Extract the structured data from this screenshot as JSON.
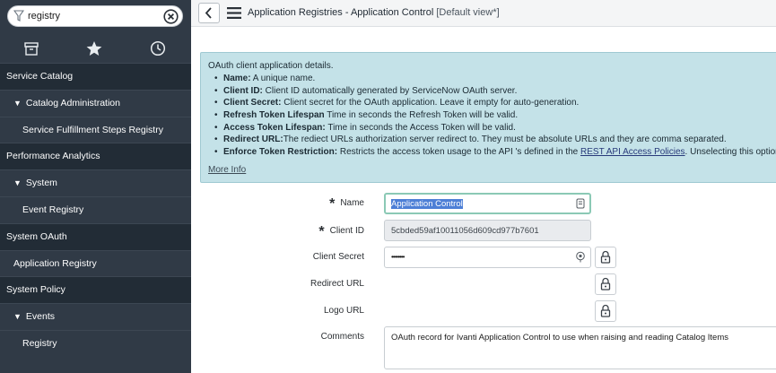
{
  "sidebar": {
    "filter_value": "registry",
    "items": [
      {
        "label": "Service Catalog",
        "level": 0
      },
      {
        "label": "Catalog Administration",
        "level": 1,
        "expanded": true
      },
      {
        "label": "Service Fulfillment Steps Registry",
        "level": 2
      },
      {
        "label": "Performance Analytics",
        "level": 0
      },
      {
        "label": "System",
        "level": 1,
        "expanded": true
      },
      {
        "label": "Event Registry",
        "level": 2
      },
      {
        "label": "System OAuth",
        "level": 0
      },
      {
        "label": "Application Registry",
        "level": 1
      },
      {
        "label": "System Policy",
        "level": 0
      },
      {
        "label": "Events",
        "level": 1,
        "expanded": true
      },
      {
        "label": "Registry",
        "level": 2
      }
    ],
    "tab_icons": [
      "archive-icon",
      "star-icon",
      "clock-icon"
    ]
  },
  "header": {
    "title": "Application Registries - Application Control",
    "view": "[Default view*]"
  },
  "info": {
    "intro": "OAuth client application details.",
    "bullets": [
      {
        "term": "Name:",
        "text": " A unique name."
      },
      {
        "term": "Client ID:",
        "text": " Client ID automatically generated by ServiceNow OAuth server."
      },
      {
        "term": "Client Secret:",
        "text": " Client secret for the OAuth application. Leave it empty for auto-generation."
      },
      {
        "term": "Refresh Token Lifespan",
        "text": " Time in seconds the Refresh Token will be valid."
      },
      {
        "term": "Access Token Lifespan:",
        "text": " Time in seconds the Access Token will be valid."
      },
      {
        "term": "Redirect URL:",
        "text": "The rediect URLs authorization server redirect to. They must be absolute URLs and they are comma separated."
      },
      {
        "term": "Enforce Token Restriction:",
        "text": " Restricts the access token usage to the API 's defined in the ",
        "link": "REST API Access Policies",
        "after": ". Unselecting this option would allow access"
      }
    ],
    "more_info": "More Info"
  },
  "form": {
    "name_label": "Name",
    "name_value": "Application Control",
    "client_id_label": "Client ID",
    "client_id_value": "5cbded59af10011056d609cd977b7601",
    "client_secret_label": "Client Secret",
    "client_secret_value": "••••••••",
    "redirect_url_label": "Redirect URL",
    "logo_url_label": "Logo URL",
    "comments_label": "Comments",
    "comments_value": "OAuth record for Ivanti Application Control to use when raising and reading Catalog Items"
  },
  "colors": {
    "sidebar_bg": "#303a46",
    "section_bg": "#222c36",
    "info_bg": "#c4e2e8",
    "focus_border": "#8bc9b5"
  }
}
